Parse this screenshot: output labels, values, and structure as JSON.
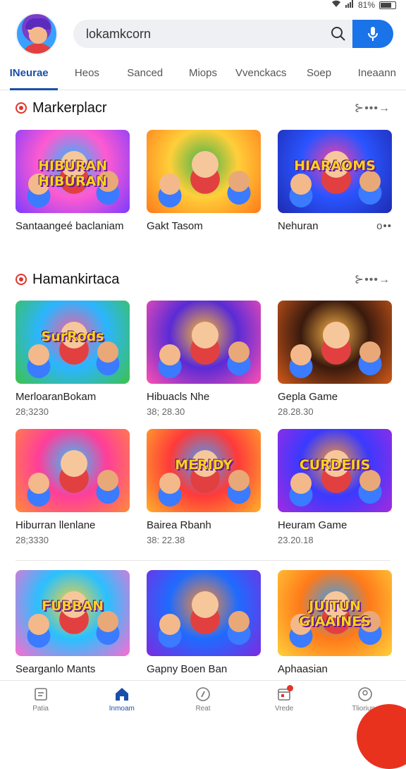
{
  "status": {
    "battery": "81%"
  },
  "search": {
    "value": "lokamkcorn"
  },
  "tabs": [
    "INeurae",
    "Heos",
    "Sanced",
    "Miops",
    "Vvenckacs",
    "Soep",
    "Ineaann"
  ],
  "sections": [
    {
      "title": "Markerplacr",
      "more": "⊱•••→",
      "cards": [
        {
          "name": "Santaangeé baclaniam",
          "meta": "",
          "banner": "HIBURAN HIBURAN",
          "colors": [
            "#ff5ad1",
            "#7b3cff",
            "#19c0ff"
          ]
        },
        {
          "name": "Gakt Tasom",
          "meta": "",
          "banner": "",
          "colors": [
            "#ffcf3a",
            "#ff7a1a",
            "#3fb24a"
          ]
        },
        {
          "name": "Nehuran",
          "meta": "",
          "banner": "HIARAOMS",
          "colors": [
            "#2a54ff",
            "#1e2bb0",
            "#ff3fa0"
          ],
          "dots": "o••"
        }
      ]
    },
    {
      "title": "Hamankirtaca",
      "more": "⊱•••→",
      "cards": [
        {
          "name": "MerloaranBokam",
          "meta": "28;3230",
          "banner": "SurRods",
          "colors": [
            "#2bb5ff",
            "#3ec24a",
            "#ff5a9a"
          ]
        },
        {
          "name": "Hibuacls Nhe",
          "meta": "38; 28.30",
          "banner": "",
          "colors": [
            "#5a2bd6",
            "#ff4fb0",
            "#ffbf2a"
          ]
        },
        {
          "name": "Gepla Game",
          "meta": "28.28.30",
          "banner": "",
          "colors": [
            "#3a1a0e",
            "#d25a1a",
            "#ffb84a"
          ]
        },
        {
          "name": "Hiburran llenlane",
          "meta": "28;3330",
          "banner": "",
          "colors": [
            "#ff3e9a",
            "#ff8a3a",
            "#2ac6ff"
          ]
        },
        {
          "name": "Bairea Rbanh",
          "meta": "38: 22.38",
          "banner": "MERIDY",
          "colors": [
            "#ff3a3a",
            "#ffb02a",
            "#3fa0ff"
          ]
        },
        {
          "name": "Heuram Game",
          "meta": "23.20.18",
          "banner": "CURDEIIS",
          "colors": [
            "#3a3aff",
            "#a22ae0",
            "#ff9a2a"
          ]
        }
      ]
    },
    {
      "title": "",
      "more": "",
      "cards": [
        {
          "name": "Searganlo Mants",
          "meta": "",
          "banner": "FUBBAN",
          "colors": [
            "#2ac0ff",
            "#ff6ad0",
            "#ffd32a"
          ]
        },
        {
          "name": "Gapny Boen Ban",
          "meta": "",
          "banner": "",
          "colors": [
            "#1f6bff",
            "#7c2ae0",
            "#ff8a2a"
          ]
        },
        {
          "name": "Aphaasian",
          "meta": "",
          "banner": "JUITUN GIAAINES",
          "colors": [
            "#ff7a1a",
            "#ffcf3a",
            "#2aa0ff"
          ]
        }
      ]
    }
  ],
  "bottom_nav": [
    {
      "label": "Patia",
      "icon": "grid-icon"
    },
    {
      "label": "Inmoam",
      "icon": "home-icon",
      "active": true
    },
    {
      "label": "Reat",
      "icon": "compass-icon"
    },
    {
      "label": "Vrede",
      "icon": "calendar-icon",
      "badge": true
    },
    {
      "label": "Tlioriuna",
      "icon": "profile-icon"
    }
  ]
}
